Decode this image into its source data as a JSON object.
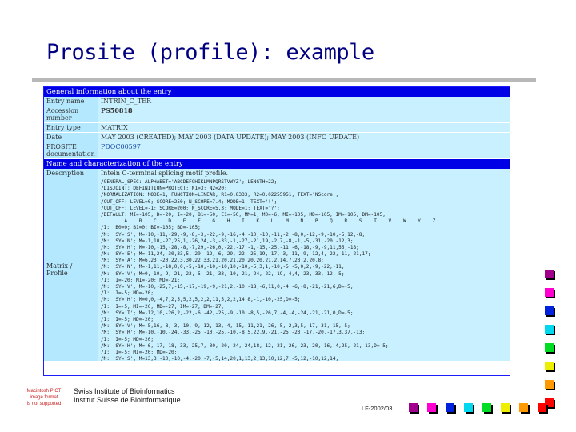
{
  "title": "Prosite (profile): example",
  "entry": {
    "general_header": "General information about the entry",
    "rows": [
      {
        "label": "Entry name",
        "value": "INTRIN_C_TER",
        "style": "plain"
      },
      {
        "label": "Accession number",
        "value": "PS50818",
        "style": "bold"
      },
      {
        "label": "Entry type",
        "value": "MATRIX",
        "style": "plain"
      },
      {
        "label": "Date",
        "value": "MAY 2003 (CREATED); MAY 2003 (DATA UPDATE); MAY 2003 (INFO UPDATE)",
        "style": "plain"
      },
      {
        "label": "PROSITE documentation",
        "value": "PDOC00597",
        "style": "link"
      }
    ],
    "name_header": "Name and characterization of the entry",
    "description": {
      "label": "Description",
      "value": "Intein C-terminal splicing motif profile."
    },
    "matrix_label": "Matrix / Profile",
    "matrix_lines": [
      "/GENERAL_SPEC: ALPHABET='ABCDEFGHIKLMNPQRSTVWYZ'; LENGTH=22;",
      "/DISJOINT: DEFINITION=PROTECT; N1=3; N2=20;",
      "/NORMALIZATION: MODE=1; FUNCTION=LINEAR; R1=0.8333; R2=0.02255951; TEXT='NScore';",
      "/CUT_OFF: LEVEL=0; SCORE=250; N_SCORE=7.4; MODE=1; TEXT='!';",
      "/CUT_OFF: LEVEL=-1; SCORE=200; N_SCORE=5.3; MODE=1; TEXT='?';",
      "/DEFAULT: MI=-105; D=-20; I=-20; B1=-50; E1=-50; MM=1; M0=-6; MI=-105; MD=-105; IM=-105; DM=-105;",
      "        A    B    C    D    E    F    G    H    I    K    L    M    N    P    Q    R    S    T    V    W    Y    Z",
      "/I:  B0=0; B1=0; BI=-105; BD=-105;",
      "/M:  SY='S'; M=-10,-11,-29,-9,-8,-3,-22,-9,-16,-4,-10,-10,-11,-2,-8,0,-12,-9,-10,-5,12,-8;",
      "/M:  SY='N'; M=-1,10,-27,25,1,-26,24,-3,-33,-1,-27,-21,19,-2,7,-8,-1,-5,-31,-20,-12,3;",
      "/M:  SY='H'; M=-10,-15,-28,-8,-7,29,-26,0,-22,-17,-1,-15,-25,-11,-6,-18,-9,-9,11,55,-18;",
      "/M:  SY='E'; M=-11,24,-30,33,5,-29,-12,-6,-29,-22,-25,19,-17,-3,-11,-9,-12,4,-22,-11,-21,17;",
      "/M:  SY='A'; M=6,23,-20,22,3,30,22,33,21,20,21,20,20,20,21,2,14,7,23,2,20,8;",
      "/M:  SY='N'; M=-1,11,-18,0,0,-5,-10,-10,-10,10,-10,-5,3,1,-10,-5,-5,0,2,-9,-22,-11;",
      "/M:  SY='V'; M=0,-10,-9,-21,-22,-5,-21,-33,-10,-21,-24,-22,-19,-4,4,-23,-33,-12,-5;",
      "/I:  I=-20; MI=-20; MD=-21;",
      "/M:  SY='V'; M=-10,-25,7,-15,-17,-19,-9,-21,2,-10,-18,-6,11,0,-4,-6,-8,-21,-21,6,D=-5;",
      "/I:  I=-5; MD=-20;",
      "/M:  SY='H'; M=0,0,-4,7,2,5,5,2,5,2,2,11,5,2,2,14,8,-1,-10,-25,D=-5;",
      "/I:  I=-5; MI=-20; MD=-27; IM=-27; DM=-27;",
      "/M:  SY='T'; M=-12,10,-26,2,-22,-6,-42,-25,-9,-10,-8,5,-26,7,-4,-4,-24,-21,-21,0,D=-5;",
      "/I:  I=-5; MD=-20;",
      "/M:  SY='V'; M=-5,16,-8,-3,-10,-9,-12,-13,-4,-15,-11,21,-26,-5,-2,3,5,-17,-31,-15,-5;",
      "/M:  SY='R'; M=-10,-10,-24,-33,-25,-10,-25,-10,-8,5,22,9,-21,-25,-23,-17,-20,-17,3,37,-13;",
      "/I:  I=-5; MD=-20;",
      "/M:  SY='H'; M=-6,-17,-18,-33,-25,7,-30,-20,-24,-24,18,-12,-21,-26,-23,-20,-16,-4,25,-21,-13,D=-5;",
      "/I:  I=-5; MI=-20; MD=-20;",
      "/M:  SY='S'; M=13,3,-10,-10,-4,-20,-7,-5,14,20,1,13,2,13,10,12,7,-5,12,-10,12,14;",
      "/I:  I=-5; MD=-20;"
    ]
  },
  "missing_image_text": [
    "Macintosh PICT",
    "image format",
    "is not supported"
  ],
  "institute_lines": [
    "Swiss Institute of Bioinformatics",
    "Institut Suisse de Bioinformatique"
  ],
  "reference": "LF-2002/03",
  "square_colors": [
    "#a0008c",
    "#ff00d0",
    "#0022dd",
    "#00d8ee",
    "#00dd22",
    "#eeee00",
    "#ff9900",
    "#ff0000"
  ]
}
